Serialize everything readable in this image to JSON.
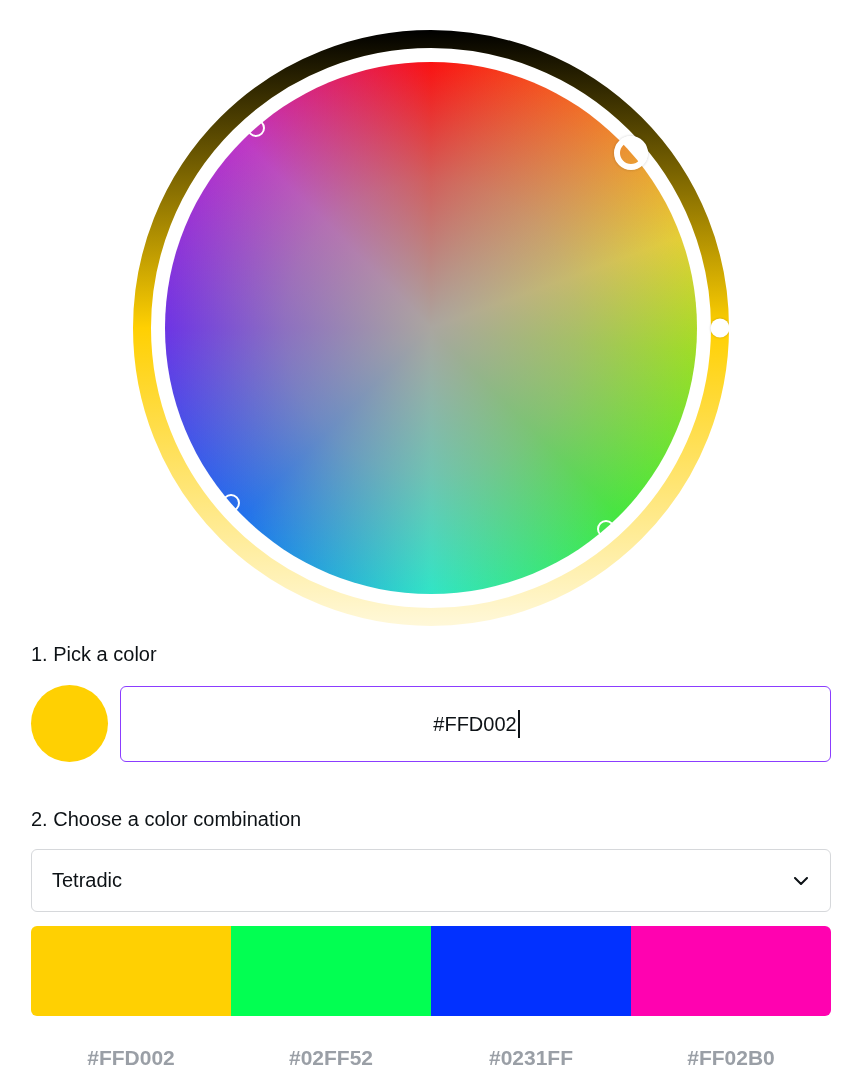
{
  "color_wheel": {
    "brightness_slider": {
      "level": 0.5
    }
  },
  "pick_color": {
    "label": "1. Pick a color",
    "color": "#ffd002",
    "hex_input": {
      "value": "#FFD002",
      "focused": true
    }
  },
  "combination": {
    "label": "2. Choose a color combination",
    "dropdown": {
      "value": "Tetradic"
    },
    "swatches": [
      {
        "color": "#ffd002",
        "hex": "#FFD002"
      },
      {
        "color": "#02ff52",
        "hex": "#02FF52"
      },
      {
        "color": "#0231ff",
        "hex": "#0231FF"
      },
      {
        "color": "#ff02b0",
        "hex": "#FF02B0"
      }
    ]
  }
}
